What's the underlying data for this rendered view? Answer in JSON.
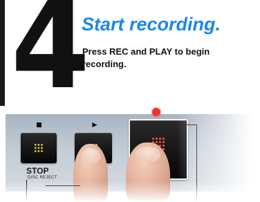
{
  "step": {
    "number": "4",
    "title": "Start recording.",
    "description": "Press REC and PLAY to begin recording."
  },
  "device": {
    "stop_label": "STOP",
    "stop_sublabel": "DISC REJECT",
    "buttons": [
      "stop",
      "play",
      "rec"
    ]
  },
  "colors": {
    "title": "#1e88e5",
    "text": "#111111",
    "rec_led": "#e53935"
  }
}
